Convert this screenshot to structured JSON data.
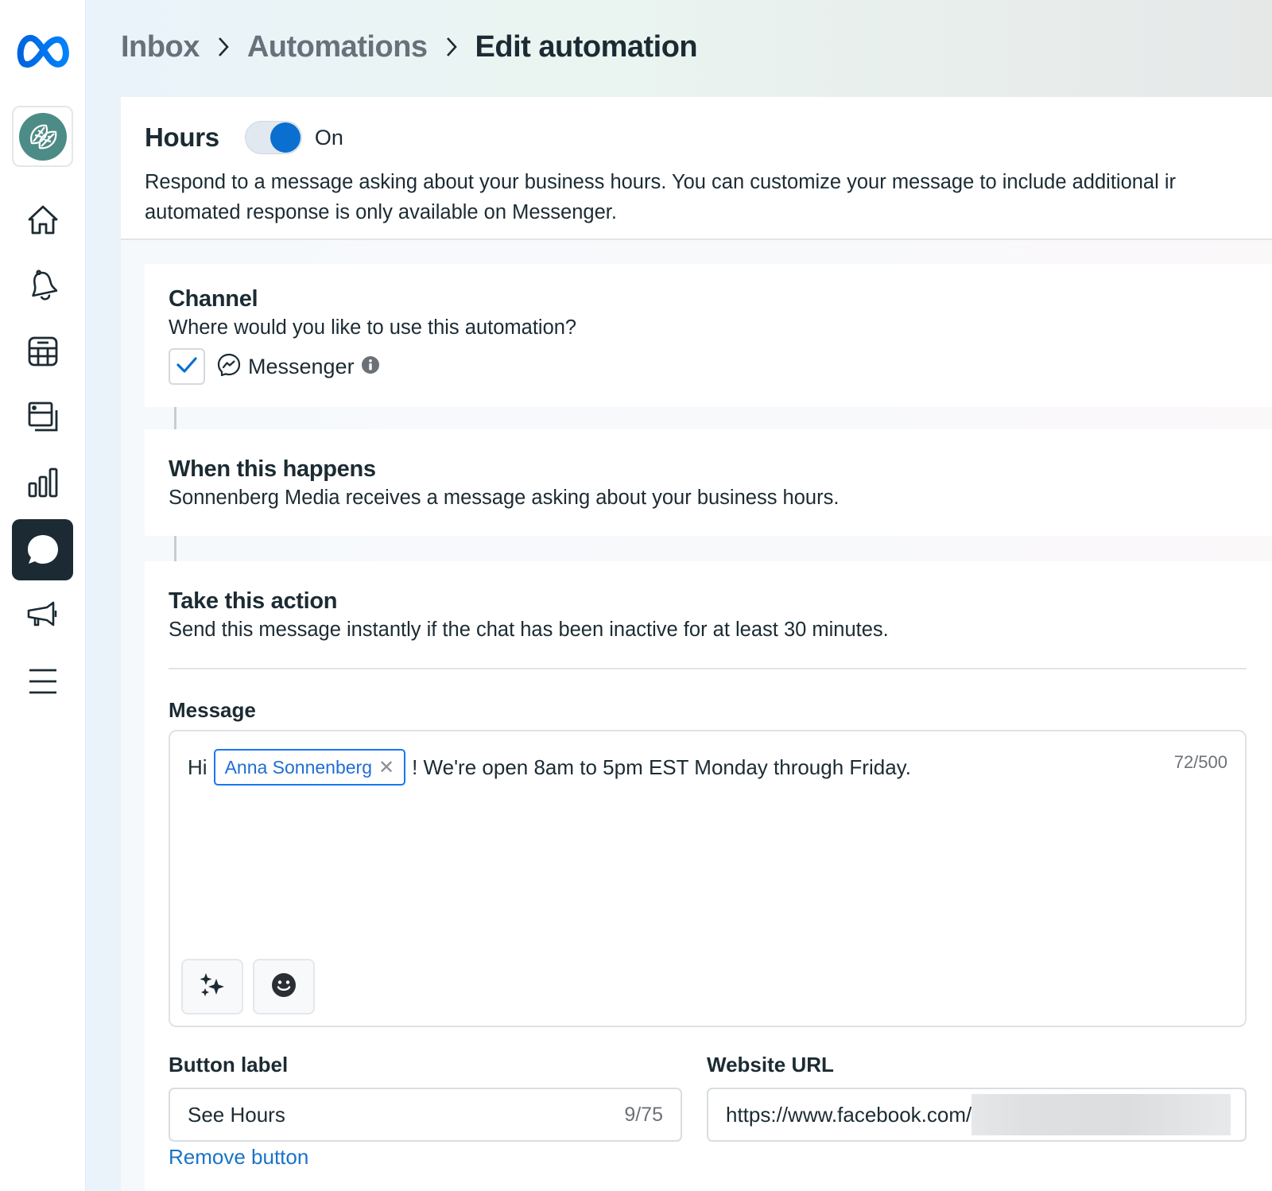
{
  "sidebar": {
    "logo": "meta-logo",
    "page_avatar": "leaf-globe-icon",
    "items": [
      {
        "id": "home",
        "icon": "home-icon",
        "active": false
      },
      {
        "id": "notifications",
        "icon": "bell-icon",
        "active": false
      },
      {
        "id": "planner",
        "icon": "calendar-grid-icon",
        "active": false
      },
      {
        "id": "content",
        "icon": "content-pages-icon",
        "active": false
      },
      {
        "id": "insights",
        "icon": "bar-chart-icon",
        "active": false
      },
      {
        "id": "inbox",
        "icon": "chat-bubble-icon",
        "active": true
      },
      {
        "id": "ads",
        "icon": "megaphone-icon",
        "active": false
      },
      {
        "id": "menu",
        "icon": "hamburger-menu-icon",
        "active": false
      }
    ]
  },
  "breadcrumb": {
    "items": [
      "Inbox",
      "Automations",
      "Edit automation"
    ],
    "separator_icon": "chevron-right-icon"
  },
  "automation": {
    "title": "Hours",
    "toggle_on": true,
    "toggle_label": "On",
    "description_line1": "Respond to a message asking about your business hours. You can customize your message to include additional ir",
    "description_line2": "automated response is only available on Messenger."
  },
  "channel": {
    "title": "Channel",
    "subtitle": "Where would you like to use this automation?",
    "option_label": "Messenger",
    "option_checked": true
  },
  "trigger": {
    "title": "When this happens",
    "subtitle": "Sonnenberg Media receives a message asking about your business hours."
  },
  "action": {
    "title": "Take this action",
    "subtitle": "Send this message instantly if the chat has been inactive for at least 30 minutes.",
    "message_label": "Message",
    "message_prefix": "Hi",
    "message_token": "Anna Sonnenberg",
    "message_suffix": "! We're open 8am to 5pm EST Monday through Friday.",
    "message_count": "72/500",
    "button_label_title": "Button label",
    "button_label_value": "See Hours",
    "button_label_count": "9/75",
    "website_url_title": "Website URL",
    "website_url_value": "https://www.facebook.com/",
    "remove_button_label": "Remove button"
  },
  "colors": {
    "accent": "#0a6fcf",
    "link": "#1a73c8",
    "text": "#1c2b33",
    "active_nav": "#1c2b33",
    "avatar_bg": "#4d8c86"
  }
}
